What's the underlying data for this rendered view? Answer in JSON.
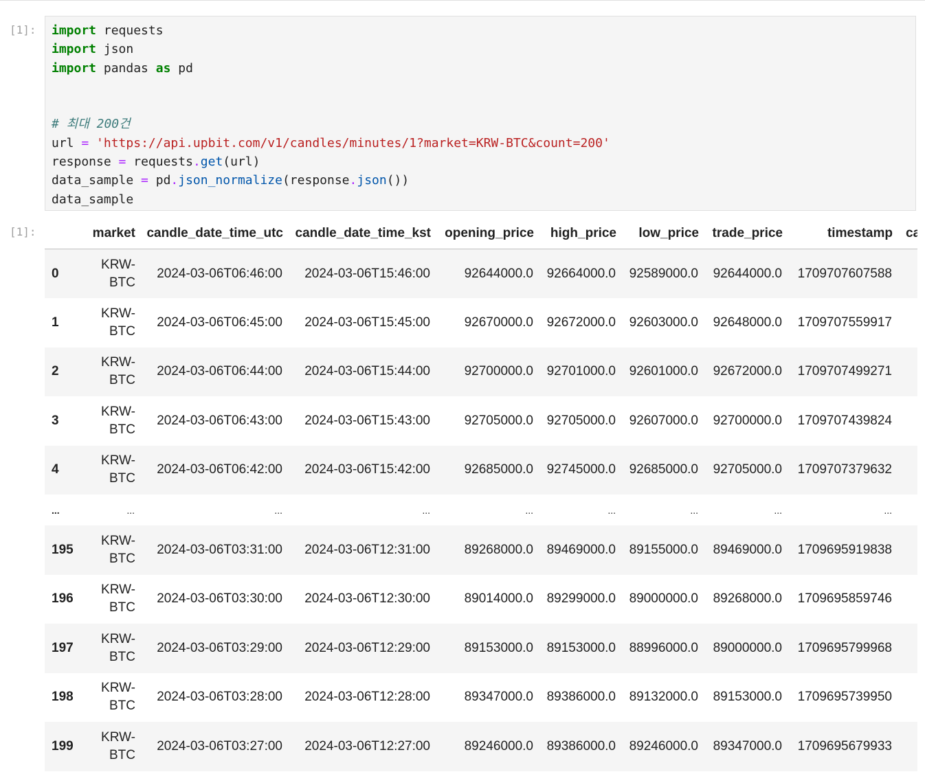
{
  "cell": {
    "in_prompt": "[1]:",
    "out_prompt": "[1]:"
  },
  "code": {
    "lines": [
      [
        {
          "t": "import",
          "c": "kw"
        },
        {
          "t": " requests",
          "c": ""
        }
      ],
      [
        {
          "t": "import",
          "c": "kw"
        },
        {
          "t": " json",
          "c": ""
        }
      ],
      [
        {
          "t": "import",
          "c": "kw"
        },
        {
          "t": " pandas ",
          "c": ""
        },
        {
          "t": "as",
          "c": "kw"
        },
        {
          "t": " pd",
          "c": ""
        }
      ],
      [],
      [],
      [
        {
          "t": "# 최대 200건",
          "c": "cm"
        }
      ],
      [
        {
          "t": "url ",
          "c": ""
        },
        {
          "t": "=",
          "c": "op"
        },
        {
          "t": " ",
          "c": ""
        },
        {
          "t": "'https://api.upbit.com/v1/candles/minutes/1?market=KRW-BTC&count=200'",
          "c": "str"
        }
      ],
      [
        {
          "t": "response ",
          "c": ""
        },
        {
          "t": "=",
          "c": "op"
        },
        {
          "t": " requests",
          "c": ""
        },
        {
          "t": ".",
          "c": "op"
        },
        {
          "t": "get",
          "c": "fn"
        },
        {
          "t": "(url)",
          "c": ""
        }
      ],
      [
        {
          "t": "data_sample ",
          "c": ""
        },
        {
          "t": "=",
          "c": "op"
        },
        {
          "t": " pd",
          "c": ""
        },
        {
          "t": ".",
          "c": "op"
        },
        {
          "t": "json_normalize",
          "c": "fn"
        },
        {
          "t": "(response",
          "c": ""
        },
        {
          "t": ".",
          "c": "op"
        },
        {
          "t": "json",
          "c": "fn"
        },
        {
          "t": "())",
          "c": ""
        }
      ],
      [
        {
          "t": "data_sample",
          "c": ""
        }
      ]
    ]
  },
  "table": {
    "columns": [
      "",
      "market",
      "candle_date_time_utc",
      "candle_date_time_kst",
      "opening_price",
      "high_price",
      "low_price",
      "trade_price",
      "timestamp",
      "ca"
    ],
    "rows": [
      {
        "index": "0",
        "market": "KRW-BTC",
        "utc": "2024-03-06T06:46:00",
        "kst": "2024-03-06T15:46:00",
        "open": "92644000.0",
        "high": "92664000.0",
        "low": "92589000.0",
        "trade": "92644000.0",
        "ts": "1709707607588"
      },
      {
        "index": "1",
        "market": "KRW-BTC",
        "utc": "2024-03-06T06:45:00",
        "kst": "2024-03-06T15:45:00",
        "open": "92670000.0",
        "high": "92672000.0",
        "low": "92603000.0",
        "trade": "92648000.0",
        "ts": "1709707559917"
      },
      {
        "index": "2",
        "market": "KRW-BTC",
        "utc": "2024-03-06T06:44:00",
        "kst": "2024-03-06T15:44:00",
        "open": "92700000.0",
        "high": "92701000.0",
        "low": "92601000.0",
        "trade": "92672000.0",
        "ts": "1709707499271"
      },
      {
        "index": "3",
        "market": "KRW-BTC",
        "utc": "2024-03-06T06:43:00",
        "kst": "2024-03-06T15:43:00",
        "open": "92705000.0",
        "high": "92705000.0",
        "low": "92607000.0",
        "trade": "92700000.0",
        "ts": "1709707439824"
      },
      {
        "index": "4",
        "market": "KRW-BTC",
        "utc": "2024-03-06T06:42:00",
        "kst": "2024-03-06T15:42:00",
        "open": "92685000.0",
        "high": "92745000.0",
        "low": "92685000.0",
        "trade": "92705000.0",
        "ts": "1709707379632"
      },
      {
        "ellipsis": true,
        "index": "...",
        "market": "...",
        "utc": "...",
        "kst": "...",
        "open": "...",
        "high": "...",
        "low": "...",
        "trade": "...",
        "ts": "..."
      },
      {
        "index": "195",
        "market": "KRW-BTC",
        "utc": "2024-03-06T03:31:00",
        "kst": "2024-03-06T12:31:00",
        "open": "89268000.0",
        "high": "89469000.0",
        "low": "89155000.0",
        "trade": "89469000.0",
        "ts": "1709695919838"
      },
      {
        "index": "196",
        "market": "KRW-BTC",
        "utc": "2024-03-06T03:30:00",
        "kst": "2024-03-06T12:30:00",
        "open": "89014000.0",
        "high": "89299000.0",
        "low": "89000000.0",
        "trade": "89268000.0",
        "ts": "1709695859746"
      },
      {
        "index": "197",
        "market": "KRW-BTC",
        "utc": "2024-03-06T03:29:00",
        "kst": "2024-03-06T12:29:00",
        "open": "89153000.0",
        "high": "89153000.0",
        "low": "88996000.0",
        "trade": "89000000.0",
        "ts": "1709695799968"
      },
      {
        "index": "198",
        "market": "KRW-BTC",
        "utc": "2024-03-06T03:28:00",
        "kst": "2024-03-06T12:28:00",
        "open": "89347000.0",
        "high": "89386000.0",
        "low": "89132000.0",
        "trade": "89153000.0",
        "ts": "1709695739950"
      },
      {
        "index": "199",
        "market": "KRW-BTC",
        "utc": "2024-03-06T03:27:00",
        "kst": "2024-03-06T12:27:00",
        "open": "89246000.0",
        "high": "89386000.0",
        "low": "89246000.0",
        "trade": "89347000.0",
        "ts": "1709695679933"
      }
    ]
  }
}
